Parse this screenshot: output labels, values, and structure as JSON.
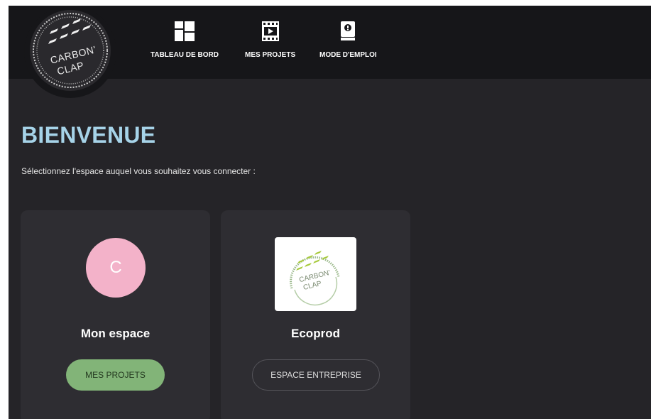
{
  "brand": {
    "logo_line1": "CARBON'",
    "logo_line2": "CLAP"
  },
  "nav": {
    "items": [
      {
        "label": "TABLEAU DE BORD",
        "icon": "dashboard-icon"
      },
      {
        "label": "MES PROJETS",
        "icon": "film-icon"
      },
      {
        "label": "MODE D'EMPLOI",
        "icon": "manual-icon"
      }
    ]
  },
  "main": {
    "title": "BIENVENUE",
    "subtitle": "Sélectionnez l'espace auquel vous souhaitez vous connecter :"
  },
  "cards": [
    {
      "avatar_letter": "C",
      "name": "Mon espace",
      "button_label": "MES PROJETS"
    },
    {
      "logo_line1": "CARBON'",
      "logo_line2": "CLAP",
      "name": "Ecoprod",
      "button_label": "ESPACE ENTREPRISE"
    }
  ],
  "colors": {
    "background": "#252428",
    "topbar": "#161619",
    "card": "#2e2d32",
    "title": "#a6d3e8",
    "avatar": "#f3b2c9",
    "primary_button": "#82b478"
  }
}
